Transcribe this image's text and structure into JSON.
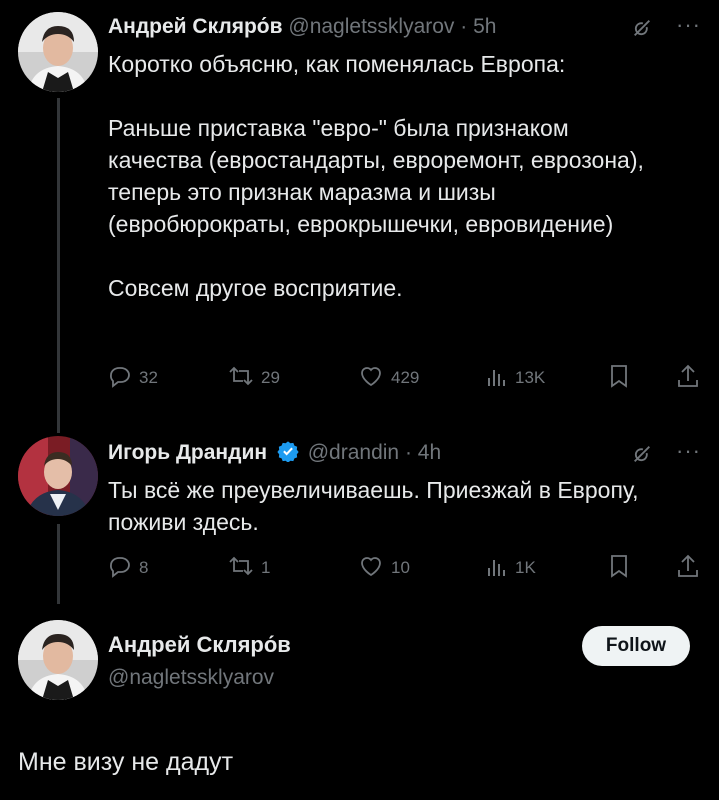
{
  "tweet1": {
    "author_name": "Андрей Скляро́в",
    "handle": "@nagletssklyarov",
    "separator": "·",
    "time": "5h",
    "text": "Коротко объясню, как поменялась Европа:\n\nРаньше приставка \"евро-\" была признаком качества (евростандарты, евроремонт, еврозона), теперь это признак маразма и шизы (еврobюрократы, еврокрышечки, евровидение)\n\nСовсем другое восприятие.",
    "replies": "32",
    "reposts": "29",
    "likes": "429",
    "views": "13K"
  },
  "tweet2": {
    "author_name": "Игорь Драндин",
    "handle": "@drandin",
    "separator": "·",
    "time": "4h",
    "text": "Ты всё же преувеличиваешь. Приезжай в Европу, поживи здесь.",
    "replies": "8",
    "reposts": "1",
    "likes": "10",
    "views": "1K"
  },
  "tweet3": {
    "author_name": "Андрей Скляро́в",
    "handle": "@nagletssklyarov",
    "follow_label": "Follow",
    "text": "Мне визу не дадут"
  },
  "icons": {
    "reply": "reply-icon",
    "repost": "repost-icon",
    "like": "heart-icon",
    "views": "views-icon",
    "bookmark": "bookmark-icon",
    "share": "share-icon",
    "grok": "grok-icon",
    "more": "more-icon",
    "verified": "verified-badge-icon"
  },
  "colors": {
    "background": "#000000",
    "text": "#e7e9ea",
    "muted": "#71767b",
    "verified": "#1d9bf0",
    "follow_bg": "#eff3f4"
  }
}
